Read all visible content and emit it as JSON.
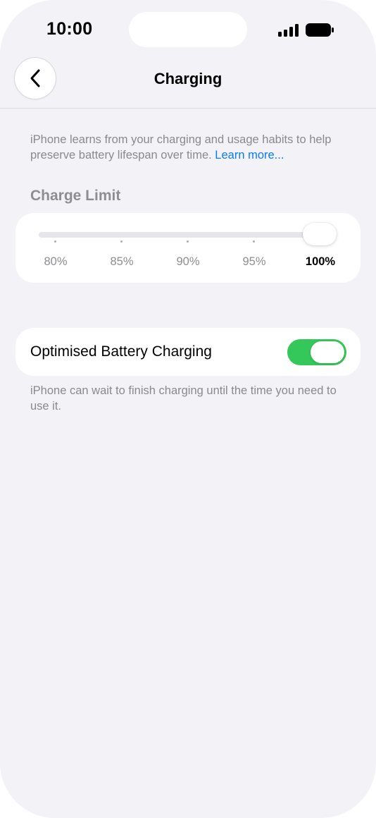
{
  "status_bar": {
    "time": "10:00"
  },
  "nav": {
    "title": "Charging"
  },
  "intro": {
    "text": "iPhone learns from your charging and usage habits to help preserve battery lifespan over time. ",
    "link": "Learn more..."
  },
  "charge_limit": {
    "header": "Charge Limit",
    "options": [
      "80%",
      "85%",
      "90%",
      "95%",
      "100%"
    ],
    "selected": "100%",
    "selected_index": 4
  },
  "optimised": {
    "label": "Optimised Battery Charging",
    "enabled": true,
    "footnote": "iPhone can wait to finish charging until the time you need to use it."
  },
  "colors": {
    "accent": "#0a7aff",
    "toggle_on": "#34c759",
    "background": "#f2f2f7"
  }
}
